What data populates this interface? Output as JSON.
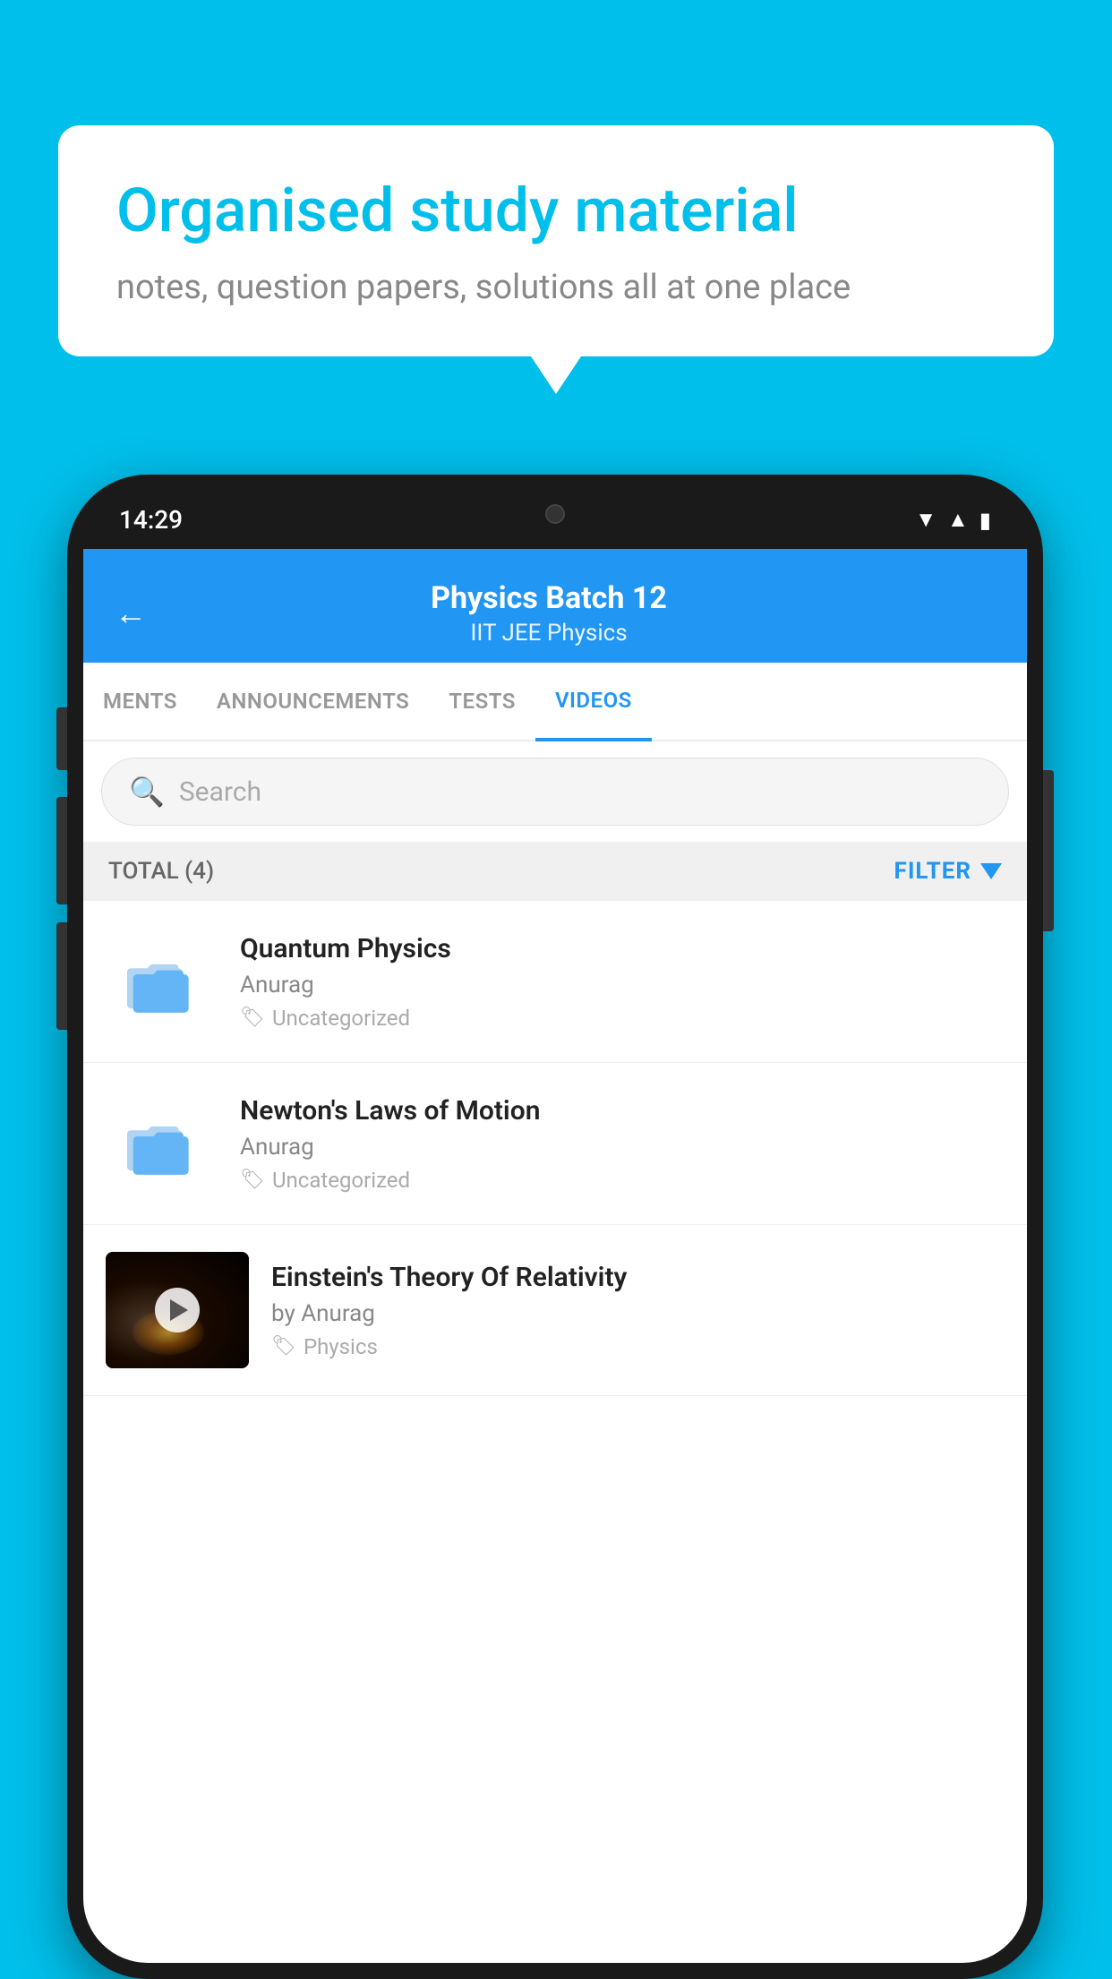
{
  "background_color": "#00BFEA",
  "speech_bubble": {
    "title": "Organised study material",
    "subtitle": "notes, question papers, solutions all at one place"
  },
  "phone": {
    "status_bar": {
      "time": "14:29"
    },
    "app_header": {
      "back_arrow": "←",
      "title": "Physics Batch 12",
      "subtitle_tags": "IIT JEE   Physics"
    },
    "tabs": [
      {
        "label": "MENTS",
        "active": false
      },
      {
        "label": "ANNOUNCEMENTS",
        "active": false
      },
      {
        "label": "TESTS",
        "active": false
      },
      {
        "label": "VIDEOS",
        "active": true
      }
    ],
    "search": {
      "placeholder": "Search"
    },
    "filter": {
      "total_label": "TOTAL (4)",
      "filter_label": "FILTER"
    },
    "video_items": [
      {
        "id": 1,
        "title": "Quantum Physics",
        "author": "Anurag",
        "tag": "Uncategorized",
        "type": "folder"
      },
      {
        "id": 2,
        "title": "Newton's Laws of Motion",
        "author": "Anurag",
        "tag": "Uncategorized",
        "type": "folder"
      },
      {
        "id": 3,
        "title": "Einstein's Theory Of Relativity",
        "author": "by Anurag",
        "tag": "Physics",
        "type": "video"
      }
    ]
  }
}
